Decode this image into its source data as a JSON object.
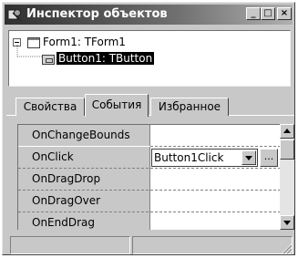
{
  "window": {
    "title": "Инспектор объектов",
    "minimize_glyph": "_",
    "maximize_glyph": "□",
    "close_glyph": "×"
  },
  "tree": {
    "items": [
      {
        "label": "Form1: TForm1",
        "icon": "form-icon",
        "expanded": true
      },
      {
        "label": "Button1: TButton",
        "icon": "button-icon",
        "selected": true
      }
    ]
  },
  "tabs": [
    {
      "label": "Свойства"
    },
    {
      "label": "События",
      "active": true
    },
    {
      "label": "Избранное"
    }
  ],
  "events": {
    "rows": [
      {
        "name": "OnChangeBounds",
        "value": ""
      },
      {
        "name": "OnClick",
        "value": "Button1Click"
      },
      {
        "name": "OnDragDrop",
        "value": ""
      },
      {
        "name": "OnDragOver",
        "value": ""
      },
      {
        "name": "OnEndDrag",
        "value": ""
      }
    ],
    "ellipsis_label": "..."
  },
  "statusbar": {
    "panels": [
      "",
      ""
    ]
  }
}
